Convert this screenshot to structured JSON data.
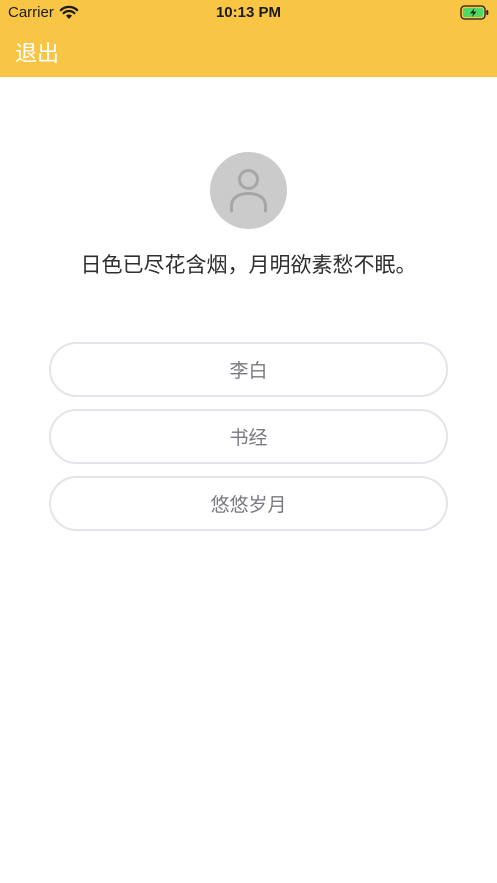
{
  "status_bar": {
    "carrier": "Carrier",
    "time": "10:13 PM",
    "icons": [
      "wifi-icon",
      "battery-charging-icon"
    ]
  },
  "nav_bar": {
    "exit_label": "退出",
    "background_color": "#f9c545"
  },
  "avatar": {
    "icon": "person-icon"
  },
  "poem": {
    "text": "日色已尽花含烟，月明欲素愁不眠。"
  },
  "options": [
    {
      "label": "李白"
    },
    {
      "label": "书经"
    },
    {
      "label": "悠悠岁月"
    }
  ]
}
